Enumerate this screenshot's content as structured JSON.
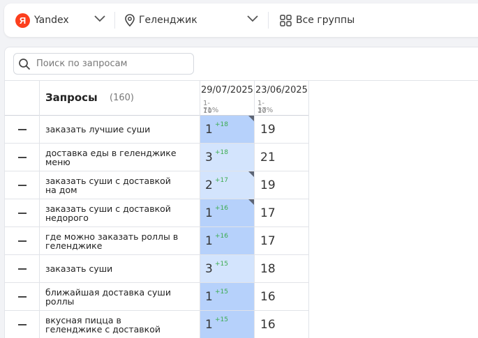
{
  "filters": {
    "engine_logo": "Я",
    "engine": "Yandex",
    "region": "Геленджик",
    "groups": "Все группы"
  },
  "search": {
    "placeholder": "Поиск по запросам"
  },
  "table": {
    "title": "Запросы",
    "count": "(160)",
    "dates": [
      {
        "date": "29/07/2025",
        "range": "1-10",
        "percent": "71%"
      },
      {
        "date": "23/06/2025",
        "range": "1-10",
        "percent": "37%"
      }
    ],
    "rows": [
      {
        "query_lines": [
          "заказать лучшие суши"
        ],
        "pos1": "1",
        "delta": "+18",
        "pos2": "19",
        "shade": "dark",
        "corner": true
      },
      {
        "query_lines": [
          "доставка еды в геленджике",
          "меню"
        ],
        "pos1": "3",
        "delta": "+18",
        "pos2": "21",
        "shade": "light",
        "corner": false
      },
      {
        "query_lines": [
          "заказать суши с доставкой",
          "на дом"
        ],
        "pos1": "2",
        "delta": "+17",
        "pos2": "19",
        "shade": "light",
        "corner": true
      },
      {
        "query_lines": [
          "заказать суши с доставкой",
          "недорого"
        ],
        "pos1": "1",
        "delta": "+16",
        "pos2": "17",
        "shade": "dark",
        "corner": true
      },
      {
        "query_lines": [
          "где можно заказать роллы в",
          "геленджике"
        ],
        "pos1": "1",
        "delta": "+16",
        "pos2": "17",
        "shade": "dark",
        "corner": false
      },
      {
        "query_lines": [
          "заказать суши"
        ],
        "pos1": "3",
        "delta": "+15",
        "pos2": "18",
        "shade": "light",
        "corner": false
      },
      {
        "query_lines": [
          "ближайшая доставка суши",
          "роллы"
        ],
        "pos1": "1",
        "delta": "+15",
        "pos2": "16",
        "shade": "dark",
        "corner": false
      },
      {
        "query_lines": [
          "вкусная пицца в",
          "геленджике с доставкой"
        ],
        "pos1": "1",
        "delta": "+15",
        "pos2": "16",
        "shade": "dark",
        "corner": false
      }
    ],
    "colors": {
      "dark": "#b6d1fb",
      "light": "#d3e4fd"
    }
  }
}
